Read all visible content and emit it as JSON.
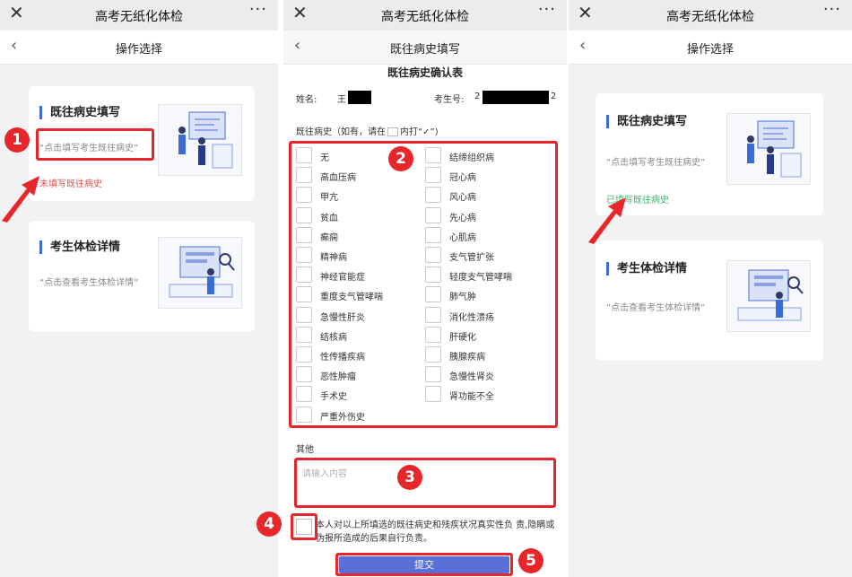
{
  "app": {
    "window_title": "高考无纸化体检",
    "close_glyph": "✕",
    "more_glyph": "···",
    "back_glyph": "‹"
  },
  "screen1": {
    "page_title": "操作选择",
    "card1": {
      "title": "既往病史填写",
      "hint": "“点击填写考生既往病史”",
      "status": "未填写既往病史"
    },
    "card2": {
      "title": "考生体检详情",
      "hint": "“点击查看考生体检详情”"
    }
  },
  "screen2": {
    "page_title": "既往病史填写",
    "form_title": "既往病史确认表",
    "name_label": "姓名:",
    "name_prefix": "王",
    "exam_no_label": "考生号:",
    "exam_no_prefix": "2",
    "exam_no_suffix": "2",
    "history_label_a": "既往病史（如有，请在",
    "history_label_b": "内打“✓”)",
    "options_left": [
      "无",
      "高血压病",
      "甲亢",
      "贫血",
      "癫痫",
      "精神病",
      "神经官能症",
      "重度支气管哮喘",
      "急慢性肝炎",
      "结核病",
      "性传播疾病",
      "恶性肿瘤",
      "手术史",
      "严重外伤史"
    ],
    "options_right": [
      "结缔组织病",
      "冠心病",
      "风心病",
      "先心病",
      "心肌病",
      "支气管扩张",
      "轻度支气管哮喘",
      "肺气肿",
      "消化性溃疡",
      "肝硬化",
      "胰腺疾病",
      "急慢性肾炎",
      "肾功能不全"
    ],
    "other_label": "其他",
    "other_placeholder": "请输入内容",
    "agreement": "本人对以上所填选的既往病史和残疾状况真实性负 责,隐瞒或伪报所造成的后果自行负责。",
    "submit_label": "提交"
  },
  "screen3": {
    "page_title": "操作选择",
    "card1": {
      "title": "既往病史填写",
      "hint": "“点击填写考生既往病史”",
      "status": "已填写既往病史"
    },
    "card2": {
      "title": "考生体检详情",
      "hint": "“点击查看考生体检详情”"
    }
  },
  "badges": [
    "1",
    "2",
    "3",
    "4",
    "5"
  ],
  "colors": {
    "annotation_red": "#e6262b",
    "accent_blue": "#3d6bd6",
    "status_unfilled": "#d9534f",
    "status_filled": "#3cb371",
    "submit_bg": "#5a6fd8"
  }
}
